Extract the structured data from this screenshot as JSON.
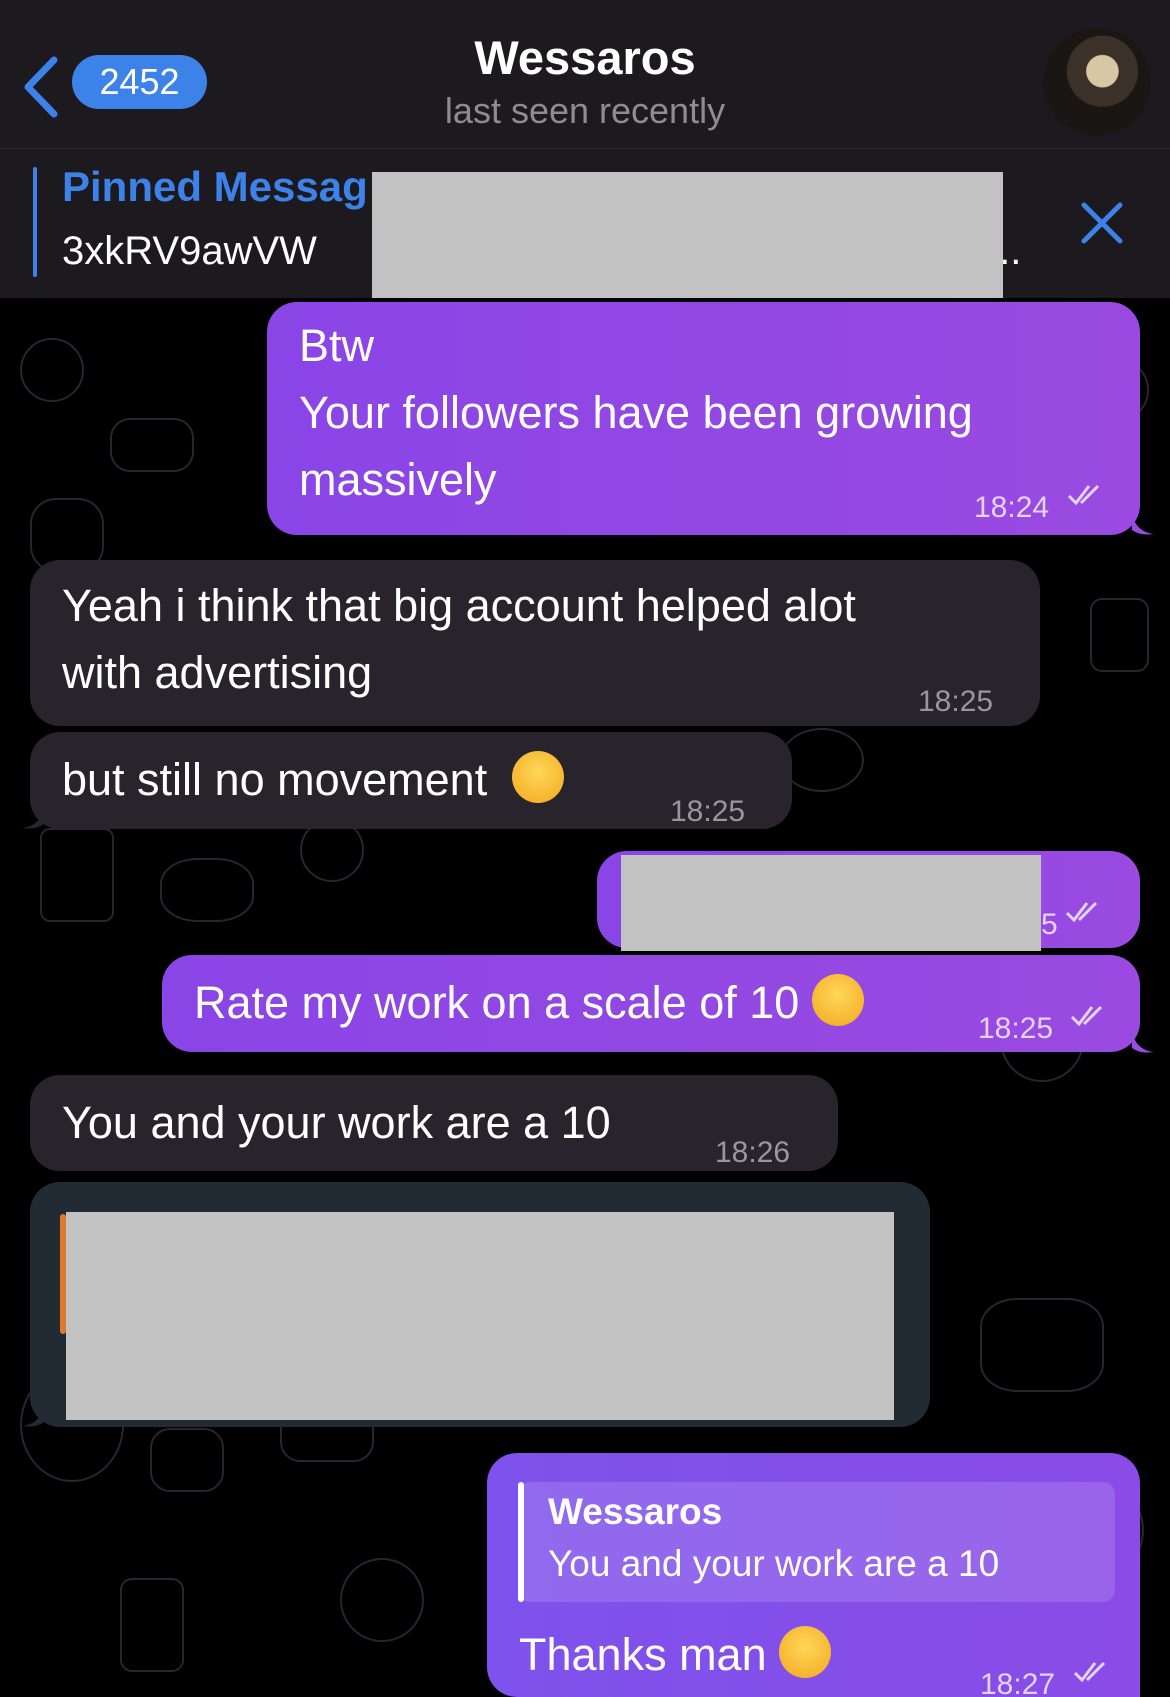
{
  "header": {
    "back_count": "2452",
    "title": "Wessaros",
    "status": "last seen recently",
    "accent_color": "#3d82e8"
  },
  "pinned": {
    "label": "Pinned Messag",
    "text_start": "3xkRV9awVW",
    "text_end": "...",
    "close_icon": "close-icon"
  },
  "messages": [
    {
      "side": "out",
      "lines": [
        "Btw",
        "Your followers have been growing",
        "massively"
      ],
      "time": "18:24",
      "read": true
    },
    {
      "side": "in",
      "lines": [
        "Yeah i think that big account helped alot",
        "with advertising"
      ],
      "time": "18:25"
    },
    {
      "side": "in",
      "text": "but still no movement",
      "emoji": "crying-face",
      "time": "18:25"
    },
    {
      "side": "out",
      "redacted": true,
      "time_partial": "5",
      "read": true
    },
    {
      "side": "out",
      "text": "Rate my work on a scale of 10",
      "emoji": "upside-down-face",
      "time": "18:25",
      "read": true
    },
    {
      "side": "in",
      "text": "You and your work are a 10",
      "time": "18:26"
    },
    {
      "side": "in",
      "redacted": true
    },
    {
      "side": "out",
      "reply_to": {
        "author": "Wessaros",
        "text": "You and your work are a 10"
      },
      "text": "Thanks man",
      "emoji": "tears-of-joy",
      "time": "18:27",
      "read": true
    }
  ],
  "colors": {
    "outgoing_bubble": "#8e47e4",
    "incoming_bubble": "#29232c",
    "header_bg": "#1c1a1f"
  }
}
